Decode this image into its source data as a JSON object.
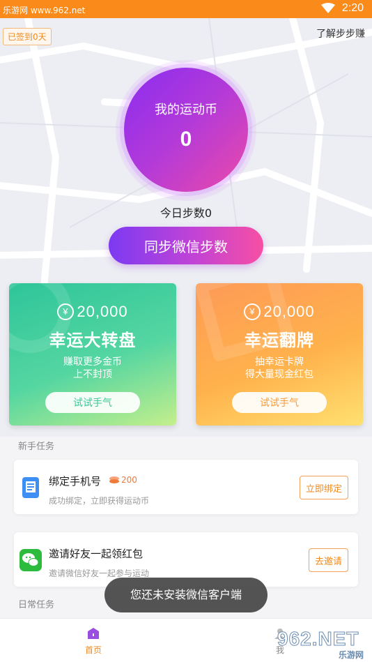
{
  "status_bar": {
    "watermark": "乐游网 www.962.net",
    "time": "2:20"
  },
  "header": {
    "checkin": "已签到0天",
    "learn": "了解步步赚"
  },
  "coin": {
    "title": "我的运动币",
    "value": "0"
  },
  "steps_today": "今日步数0",
  "sync_button": "同步微信步数",
  "cards": [
    {
      "amount": "20,000",
      "title": "幸运大转盘",
      "sub1": "赚取更多金币",
      "sub2": "上不封顶",
      "try": "试试手气"
    },
    {
      "amount": "20,000",
      "title": "幸运翻牌",
      "sub1": "抽幸运卡牌",
      "sub2": "得大量现金红包",
      "try": "试试手气"
    }
  ],
  "sections": {
    "newbie": "新手任务",
    "daily": "日常任务"
  },
  "tasks": [
    {
      "title": "绑定手机号",
      "reward": "200",
      "desc": "成功绑定，立即获得运动币",
      "button": "立即绑定"
    },
    {
      "title": "邀请好友一起领红包",
      "desc": "邀请微信好友一起参与运动",
      "button": "去邀请"
    }
  ],
  "toast": "您还未安装微信客户端",
  "tabbar": {
    "home": "首页",
    "me": "我"
  },
  "logo": {
    "main": "962.NET",
    "sub": "乐游网"
  },
  "colors": {
    "status_bar": "#fa8a1a",
    "accent": "#f08a1e",
    "coin_gradient_start": "#8a2cf0",
    "coin_gradient_end": "#ec4aa8"
  }
}
